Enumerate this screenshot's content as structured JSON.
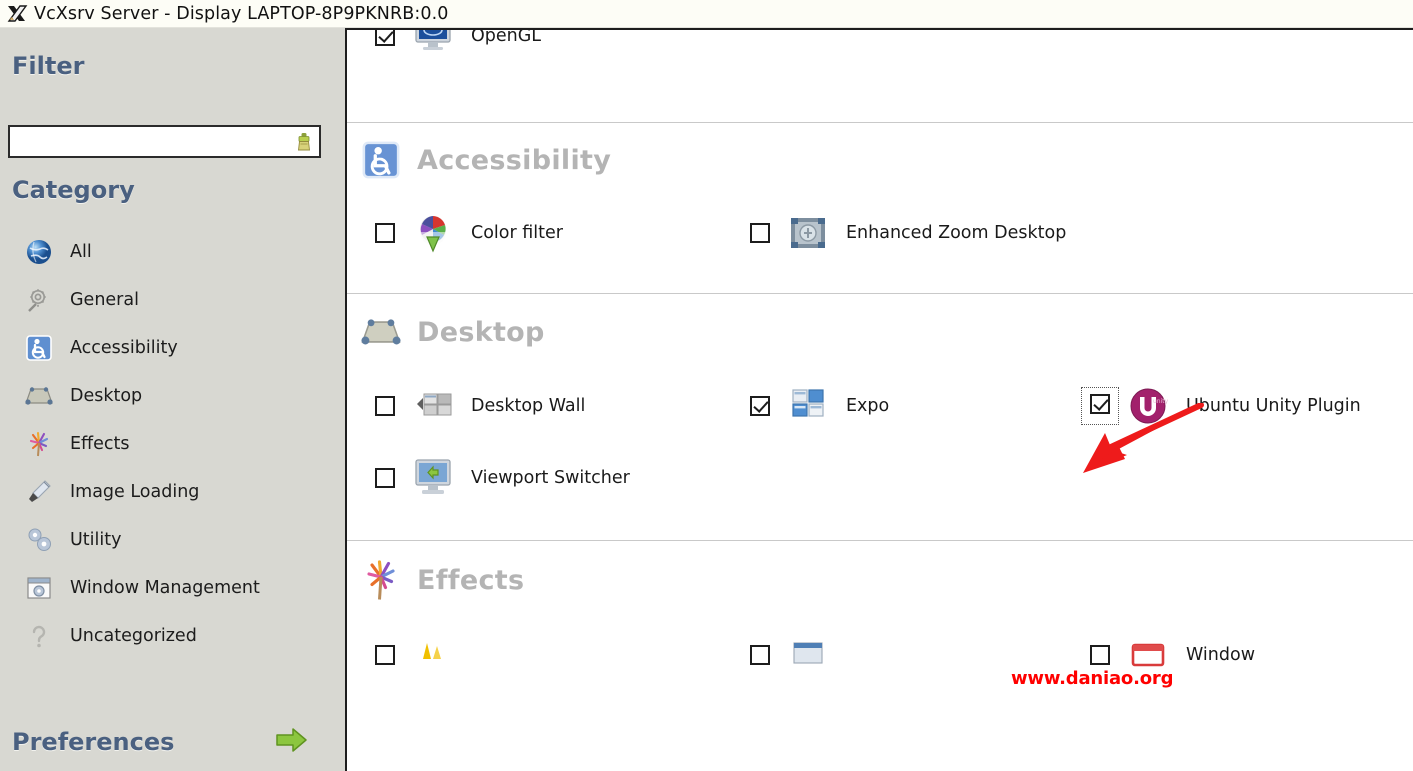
{
  "window": {
    "title": "VcXsrv Server - Display LAPTOP-8P9PKNRB:0.0",
    "app_icon": "vcxsrv-x-icon"
  },
  "sidebar": {
    "filter_heading": "Filter",
    "filter_input_value": "",
    "filter_input_placeholder": "",
    "filter_clear_icon": "broom-clear-icon",
    "category_heading": "Category",
    "categories": [
      {
        "label": "All",
        "icon": "globe-icon"
      },
      {
        "label": "General",
        "icon": "gears-wand-icon"
      },
      {
        "label": "Accessibility",
        "icon": "wheelchair-icon"
      },
      {
        "label": "Desktop",
        "icon": "desktop-icon"
      },
      {
        "label": "Effects",
        "icon": "fireworks-icon"
      },
      {
        "label": "Image Loading",
        "icon": "paintbrush-icon"
      },
      {
        "label": "Utility",
        "icon": "blue-gears-icon"
      },
      {
        "label": "Window Management",
        "icon": "window-gear-icon"
      },
      {
        "label": "Uncategorized",
        "icon": "question-mark-icon"
      }
    ],
    "preferences_label": "Preferences",
    "preferences_arrow_icon": "green-right-arrow-icon"
  },
  "content": {
    "clipped_top_row": {
      "label": "OpenGL",
      "icon": "opengl-monitor-icon",
      "checked": true
    },
    "sections": [
      {
        "title": "Accessibility",
        "icon": "wheelchair-icon",
        "plugins": [
          {
            "label": "Color filter",
            "icon": "color-filter-icon",
            "checked": false,
            "focused": false
          },
          {
            "label": "Enhanced Zoom Desktop",
            "icon": "enhanced-zoom-icon",
            "checked": false,
            "focused": false
          }
        ]
      },
      {
        "title": "Desktop",
        "icon": "desktop-icon",
        "plugins": [
          {
            "label": "Desktop Wall",
            "icon": "desktop-wall-icon",
            "checked": false,
            "focused": false
          },
          {
            "label": "Expo",
            "icon": "expo-icon",
            "checked": true,
            "focused": false
          },
          {
            "label": "Ubuntu Unity Plugin",
            "icon": "ubuntu-unity-icon",
            "checked": true,
            "focused": true
          },
          {
            "label": "Viewport Switcher",
            "icon": "viewport-switcher-icon",
            "checked": false,
            "focused": false
          }
        ]
      },
      {
        "title": "Effects",
        "icon": "fireworks-icon",
        "plugins": [
          {
            "label": "Window",
            "icon": "window-decoration-icon",
            "checked": false,
            "focused": false
          }
        ]
      }
    ]
  },
  "annotations": {
    "watermark": "www.daniao.org",
    "arrow_color": "#ee1b1b",
    "arrow_target": "ubuntu-unity-plugin-checkbox"
  },
  "colors": {
    "sidebar_bg": "#d8d8d2",
    "panel_bg": "#ffffff",
    "heading_blue": "#4a6080",
    "section_gray": "#b4b4b4",
    "watermark_red": "#ff0000",
    "unity_magenta": "#a2216c"
  }
}
